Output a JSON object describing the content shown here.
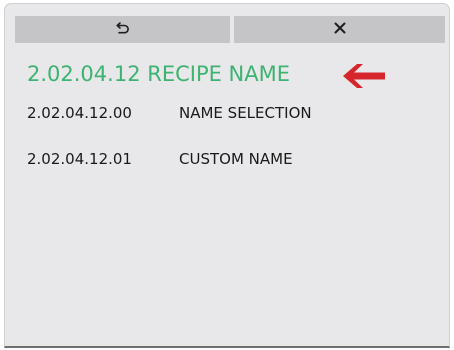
{
  "toolbar": {
    "back_icon": "undo-arrow-icon",
    "close_icon": "close-x-icon"
  },
  "header": {
    "title": "2.02.04.12 RECIPE NAME",
    "indicator_icon": "left-arrow-icon",
    "title_color": "#3cb371",
    "indicator_color": "#d6262c"
  },
  "menu": {
    "items": [
      {
        "code": "2.02.04.12.00",
        "label": "NAME SELECTION"
      },
      {
        "code": "2.02.04.12.01",
        "label": "CUSTOM NAME"
      }
    ]
  }
}
